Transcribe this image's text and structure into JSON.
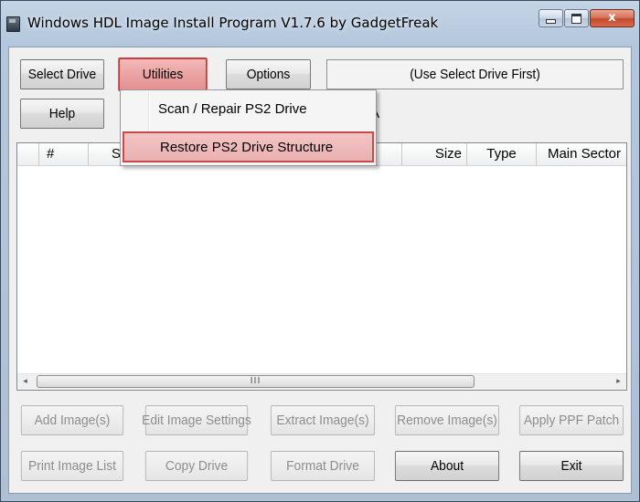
{
  "window": {
    "title": "Windows HDL Image Install Program V1.7.6 by GadgetFreak",
    "controls": {
      "minimize": "",
      "maximize": "",
      "close": "x"
    }
  },
  "toolbar": {
    "select_drive": "Select Drive",
    "utilities": "Utilities",
    "options": "Options",
    "help": "Help",
    "status": "(Use Select Drive First)",
    "drive_info": "A"
  },
  "utilities_menu": {
    "items": [
      {
        "label": "Scan / Repair PS2 Drive"
      },
      {
        "label": "Restore PS2 Drive Structure"
      }
    ]
  },
  "image_list": {
    "columns": [
      "",
      "#",
      "S",
      "Size",
      "Type",
      "Main Sector"
    ],
    "rows": [],
    "scrollbar": {
      "left_arrow": "◂",
      "right_arrow": "▸",
      "grip": "III"
    }
  },
  "actions": {
    "add_images": "Add Image(s)",
    "edit_image_settings": "Edit Image Settings",
    "extract_images": "Extract Image(s)",
    "remove_images": "Remove Image(s)",
    "apply_ppf_patch": "Apply PPF Patch",
    "print_image_list": "Print Image List",
    "copy_drive": "Copy Drive",
    "format_drive": "Format Drive",
    "about": "About",
    "exit": "Exit"
  },
  "colors": {
    "highlight_fill": "#f4c4c4",
    "highlight_border": "#c84a4a",
    "disabled_text": "#8d8d8d"
  }
}
